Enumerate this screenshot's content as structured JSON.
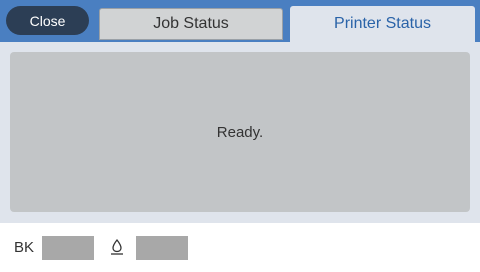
{
  "header": {
    "close_label": "Close",
    "tabs": [
      {
        "label": "Job Status",
        "selected": false
      },
      {
        "label": "Printer Status",
        "selected": true
      }
    ]
  },
  "main": {
    "status_text": "Ready."
  },
  "footer": {
    "ink_label": "BK",
    "ink_icon": "ink-drop-icon",
    "maintenance_icon": "maintenance-box-icon"
  },
  "colors": {
    "accent": "#4a7fc1",
    "close_button": "#2c3e55",
    "selected_tab_text": "#2a63a8",
    "panel": "#c2c5c7",
    "ink_bar": "#a8a8a8"
  }
}
